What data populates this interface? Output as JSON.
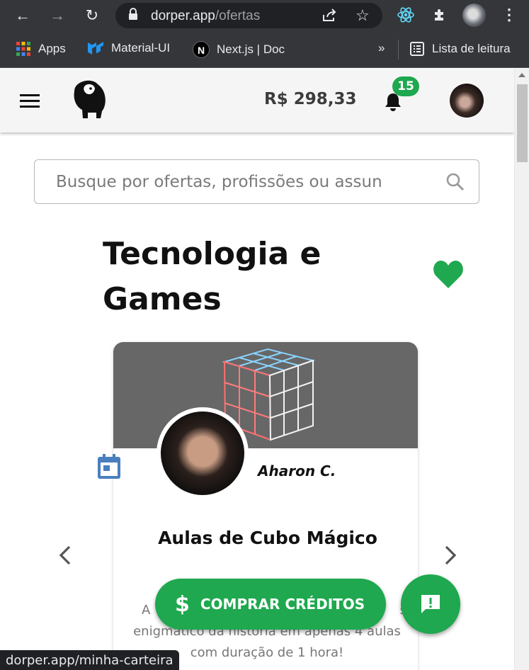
{
  "browser": {
    "url_domain": "dorper.app",
    "url_path": "/ofertas",
    "bookmarks": [
      "Apps",
      "Material-UI",
      "Next.js | Doc",
      "Lista de leitura"
    ],
    "bookmarks_more": "»"
  },
  "header": {
    "balance": "R$ 298,33",
    "notification_count": "15"
  },
  "search": {
    "placeholder": "Busque por ofertas, profissões ou assun"
  },
  "category": {
    "title": "Tecnologia e Games",
    "favorite_color": "#1fa84f"
  },
  "offer": {
    "teacher": "Aharon C.",
    "title": "Aulas de Cubo Mágico",
    "description_partial_left": "A",
    "description_partial_right": "s",
    "description_line2": "enigmático da história em apenas 4 aulas",
    "description_line3": "com duração de 1 hora!"
  },
  "actions": {
    "buy_credits": "COMPRAR CRÉDITOS"
  },
  "status_link": "dorper.app/minha-carteira",
  "colors": {
    "accent": "#1fa84f",
    "appbar": "#f5f5f5",
    "calendar_icon": "#4a7fbf"
  }
}
